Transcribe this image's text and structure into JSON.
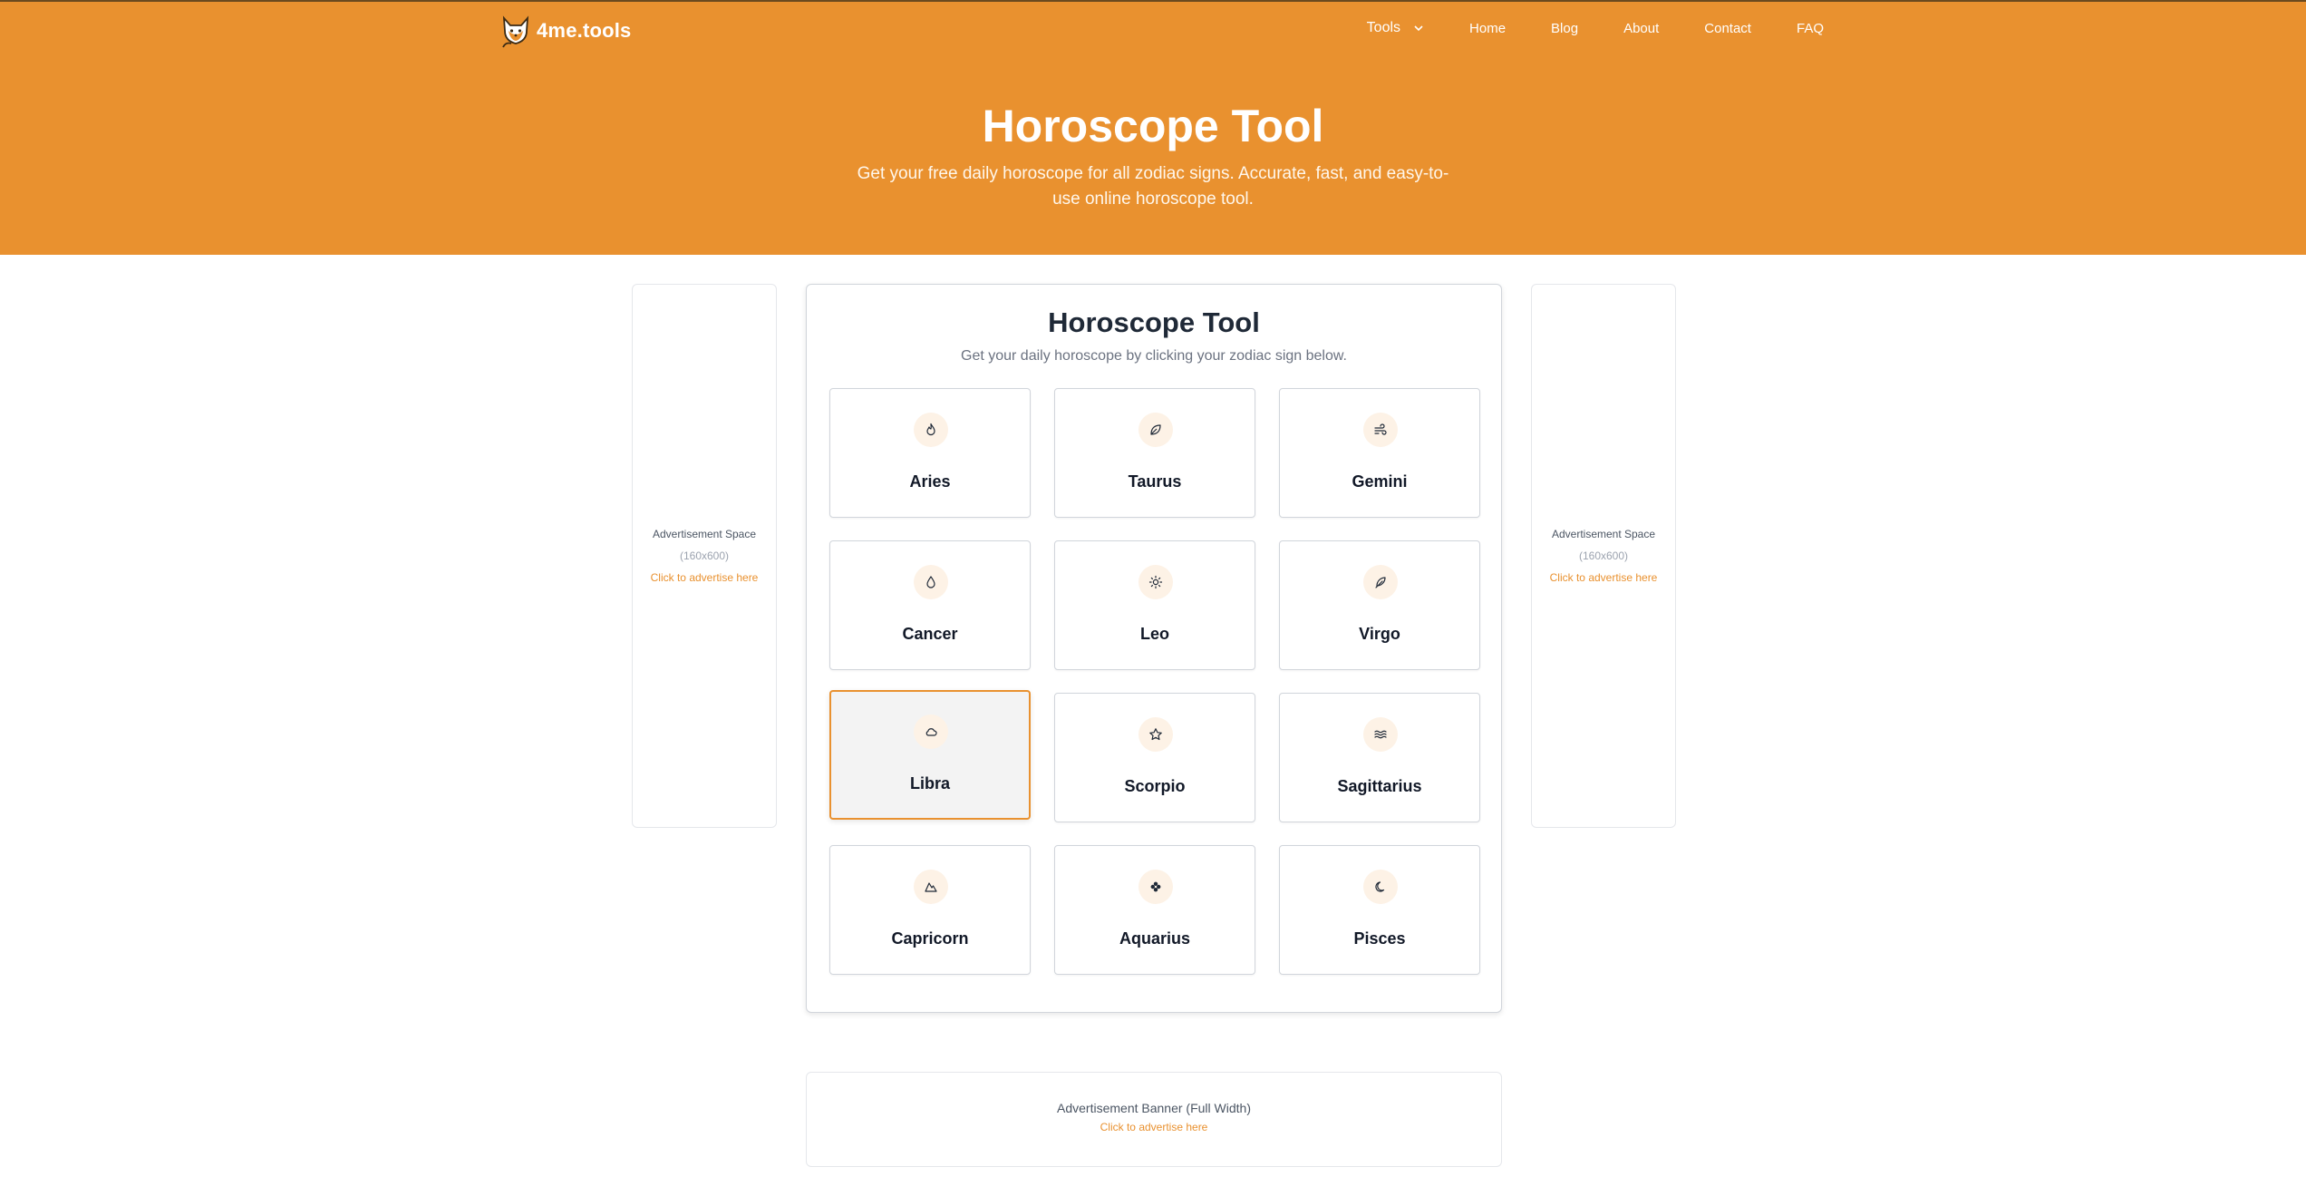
{
  "brand": {
    "name": "4me.tools",
    "accent": "#e9912f"
  },
  "nav": {
    "tools_label": "Tools",
    "links": [
      "Home",
      "Blog",
      "About",
      "Contact",
      "FAQ"
    ]
  },
  "hero": {
    "title": "Horoscope Tool",
    "subtitle": "Get your free daily horoscope for all zodiac signs. Accurate, fast, and easy-to-use online horoscope tool."
  },
  "ads": {
    "side_title": "Advertisement Space",
    "side_size": "(160x600)",
    "side_link": "Click to advertise here",
    "banner_title": "Advertisement Banner (Full Width)",
    "banner_link": "Click to advertise here"
  },
  "tool": {
    "title": "Horoscope Tool",
    "subtitle": "Get your daily horoscope by clicking your zodiac sign below.",
    "signs": [
      {
        "name": "Aries",
        "icon": "flame-icon"
      },
      {
        "name": "Taurus",
        "icon": "leaf-icon"
      },
      {
        "name": "Gemini",
        "icon": "wind-icon"
      },
      {
        "name": "Cancer",
        "icon": "droplet-icon"
      },
      {
        "name": "Leo",
        "icon": "sun-icon"
      },
      {
        "name": "Virgo",
        "icon": "feather-icon"
      },
      {
        "name": "Libra",
        "icon": "cloud-icon"
      },
      {
        "name": "Scorpio",
        "icon": "star-icon"
      },
      {
        "name": "Sagittarius",
        "icon": "waves-icon"
      },
      {
        "name": "Capricorn",
        "icon": "mountain-icon"
      },
      {
        "name": "Aquarius",
        "icon": "clover-icon"
      },
      {
        "name": "Pisces",
        "icon": "moon-icon"
      }
    ],
    "active_sign": "Libra"
  }
}
